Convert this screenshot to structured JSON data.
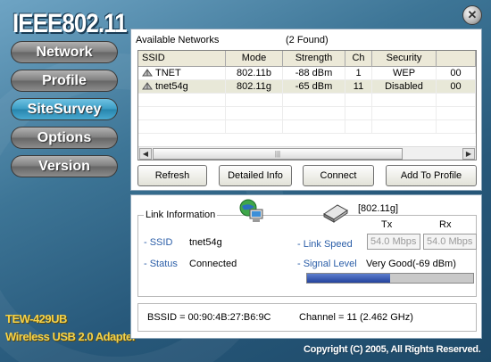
{
  "app": {
    "brand": "IEEE802.11",
    "product_line1": "TEW-429UB",
    "product_line2": "Wireless USB 2.0 Adapter",
    "copyright": "Copyright (C) 2005, All Rights Reserved.",
    "close_symbol": "✕"
  },
  "nav": {
    "items": [
      "Network",
      "Profile",
      "SiteSurvey",
      "Options",
      "Version"
    ],
    "active": "SiteSurvey"
  },
  "site_survey": {
    "available_label": "Available Networks",
    "found_count": "(2 Found)",
    "columns": [
      "SSID",
      "Mode",
      "Strength",
      "Ch",
      "Security",
      ""
    ],
    "rows": [
      {
        "ssid": "TNET",
        "mode": "802.11b",
        "strength": "-88 dBm",
        "ch": "1",
        "security": "WEP",
        "extra": "00"
      },
      {
        "ssid": "tnet54g",
        "mode": "802.11g",
        "strength": "-65 dBm",
        "ch": "11",
        "security": "Disabled",
        "extra": "00"
      }
    ],
    "selected_row": 1,
    "scroll": {
      "left_arrow": "◀",
      "right_arrow": "▶",
      "grip": "|||"
    },
    "buttons": {
      "refresh": "Refresh",
      "detailed": "Detailed Info",
      "connect": "Connect",
      "add_profile": "Add To Profile"
    }
  },
  "link_info": {
    "title": "Link Information",
    "mode": "[802.11g]",
    "ssid_label": "- SSID",
    "ssid_value": "tnet54g",
    "status_label": "- Status",
    "status_value": "Connected",
    "tx_label": "Tx",
    "rx_label": "Rx",
    "link_speed_label": "- Link Speed",
    "tx_speed": "54.0 Mbps",
    "rx_speed": "54.0 Mbps",
    "signal_label": "- Signal Level",
    "signal_value": "Very Good(-69 dBm)",
    "signal_fraction": 0.5
  },
  "footer_info": {
    "bssid": "BSSID = 00:90:4B:27:B6:9C",
    "channel": "Channel = 11 (2.462 GHz)"
  },
  "icons": [
    "close-icon",
    "network-globe-icon",
    "wireless-adapter-icon",
    "row-network-icon"
  ],
  "colors": {
    "nav_active": "#3a9cc4",
    "signal_fill": "#24439c",
    "label_blue": "#2b5ea8",
    "product_text": "#f4d24a"
  }
}
